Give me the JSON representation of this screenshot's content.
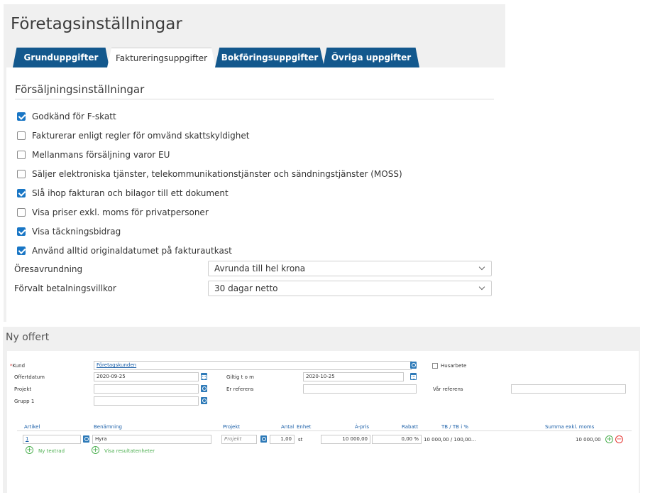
{
  "settings": {
    "title": "Företagsinställningar",
    "tabs": [
      {
        "label": "Grunduppgifter"
      },
      {
        "label": "Faktureringsuppgifter"
      },
      {
        "label": "Bokföringsuppgifter"
      },
      {
        "label": "Övriga uppgifter"
      }
    ],
    "active_tab": "Faktureringsuppgifter",
    "section_title": "Försäljningsinställningar",
    "options": [
      {
        "label": "Godkänd för F-skatt",
        "checked": true
      },
      {
        "label": "Fakturerar enligt regler för omvänd skattskyldighet",
        "checked": false
      },
      {
        "label": "Mellanmans försäljning varor EU",
        "checked": false
      },
      {
        "label": "Säljer elektroniska tjänster, telekommunikationstjänster och sändningstjänster (MOSS)",
        "checked": false
      },
      {
        "label": "Slå ihop fakturan och bilagor till ett dokument",
        "checked": true
      },
      {
        "label": "Visa priser exkl. moms för privatpersoner",
        "checked": false
      },
      {
        "label": "Visa täckningsbidrag",
        "checked": true
      },
      {
        "label": "Använd alltid originaldatumet på fakturautkast",
        "checked": true
      }
    ],
    "rounding": {
      "label": "Öresavrundning",
      "value": "Avrunda till hel krona"
    },
    "payment_terms": {
      "label": "Förvalt betalningsvillkor",
      "value": "30 dagar netto"
    }
  },
  "offer": {
    "title": "Ny offert",
    "customer": {
      "required_mark": "*",
      "label": "Kund",
      "value": "Företagskunden"
    },
    "husarbete_label": "Husarbete",
    "offer_date": {
      "label": "Offertdatum",
      "value": "2020-09-25"
    },
    "valid_to": {
      "label": "Giltig t o m",
      "value": "2020-10-25"
    },
    "project": {
      "label": "Projekt",
      "value": ""
    },
    "their_ref": {
      "label": "Er referens",
      "value": ""
    },
    "our_ref": {
      "label": "Vår referens",
      "value": ""
    },
    "group1": {
      "label": "Grupp 1",
      "value": ""
    },
    "columns": {
      "article": "Artikel",
      "name": "Benämning",
      "project": "Projekt",
      "qty": "Antal",
      "unit": "Enhet",
      "unit_price": "À-pris",
      "discount": "Rabatt",
      "margin": "TB / TB i %",
      "sum": "Summa exkl. moms"
    },
    "rows": [
      {
        "article": "1",
        "name": "Hyra",
        "project_placeholder": "Projekt",
        "qty": "1,00",
        "unit": "st",
        "unit_price": "10 000,00",
        "discount": "0,00 %",
        "margin": "10 000,00 / 100,00...",
        "sum": "10 000,00"
      }
    ],
    "add_text_row": "Ny textrad",
    "show_result_units": "Visa resultatenheter"
  }
}
